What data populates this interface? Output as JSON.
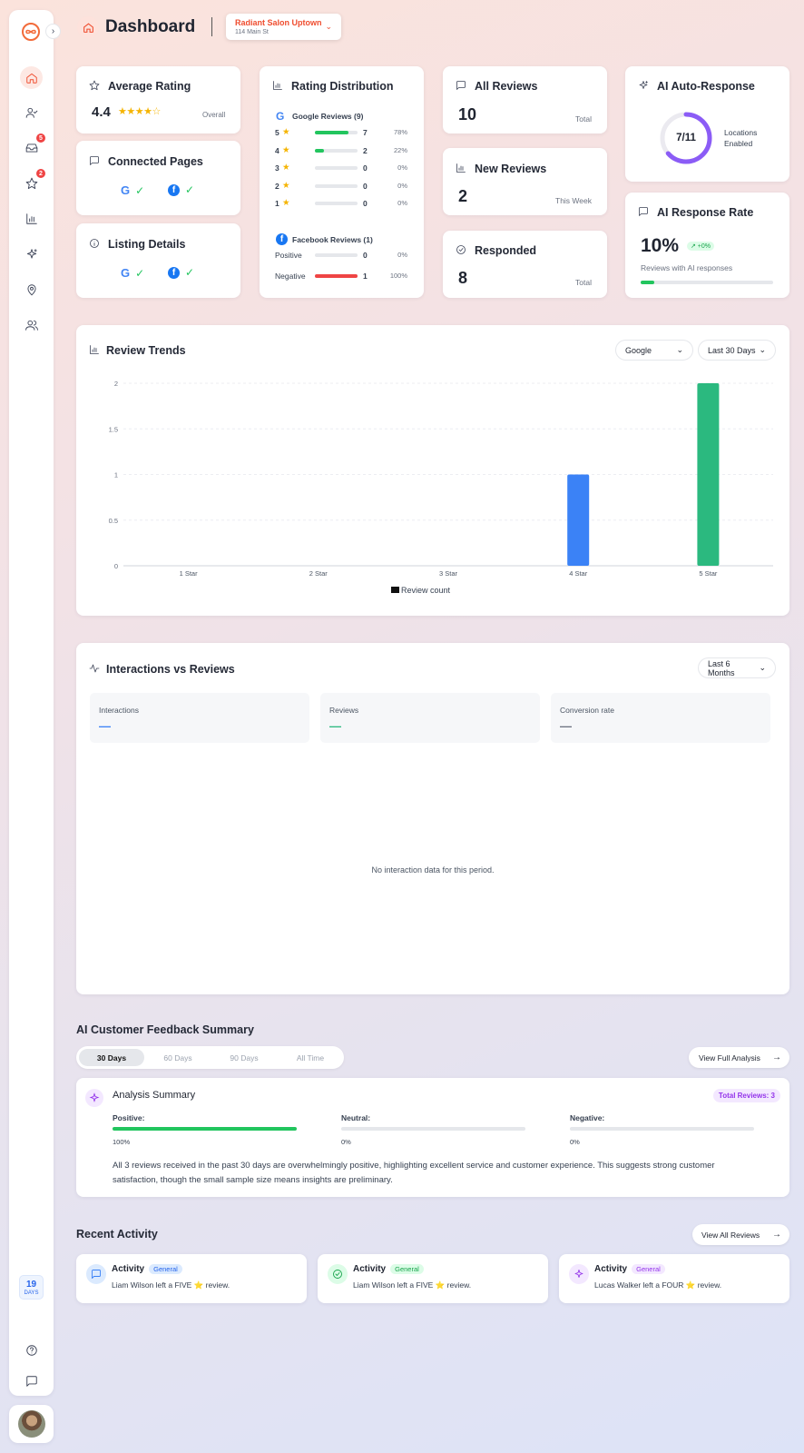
{
  "header": {
    "title": "Dashboard",
    "location_name": "Radiant Salon Uptown",
    "location_address": "114 Main St"
  },
  "sidebar": {
    "badge_inbox": "5",
    "badge_reviews": "2",
    "trial_days": "19",
    "trial_unit": "DAYS"
  },
  "avg_rating": {
    "title": "Average Rating",
    "value": "4.4",
    "stars": "★★★★☆",
    "label": "Overall",
    "rating": 4.4
  },
  "connected": {
    "title": "Connected Pages"
  },
  "listing": {
    "title": "Listing Details"
  },
  "dist": {
    "title": "Rating Distribution",
    "google_label": "Google Reviews (9)",
    "google_rows": [
      {
        "star": "5",
        "count": "7",
        "pct": "78%",
        "frac": 0.78
      },
      {
        "star": "4",
        "count": "2",
        "pct": "22%",
        "frac": 0.22
      },
      {
        "star": "3",
        "count": "0",
        "pct": "0%",
        "frac": 0
      },
      {
        "star": "2",
        "count": "0",
        "pct": "0%",
        "frac": 0
      },
      {
        "star": "1",
        "count": "0",
        "pct": "0%",
        "frac": 0
      }
    ],
    "facebook_label": "Facebook Reviews (1)",
    "fb_rows": [
      {
        "label": "Positive",
        "count": "0",
        "pct": "0%",
        "frac": 0
      },
      {
        "label": "Negative",
        "count": "1",
        "pct": "100%",
        "frac": 1
      }
    ]
  },
  "all_reviews": {
    "title": "All Reviews",
    "value": "10",
    "label": "Total"
  },
  "new_reviews": {
    "title": "New Reviews",
    "value": "2",
    "label": "This Week"
  },
  "responded": {
    "title": "Responded",
    "value": "8",
    "label": "Total"
  },
  "auto": {
    "title": "AI Auto-Response",
    "value": "7/11",
    "line1": "Locations",
    "line2": "Enabled",
    "frac": 0.636
  },
  "rate": {
    "title": "AI Response Rate",
    "value": "10%",
    "delta": "↗ +0%",
    "label": "Reviews with AI responses",
    "frac": 0.1
  },
  "trends": {
    "title": "Review Trends",
    "source": "Google",
    "range": "Last 30 Days"
  },
  "chart_data": {
    "type": "bar",
    "categories": [
      "1 Star",
      "2 Star",
      "3 Star",
      "4 Star",
      "5 Star"
    ],
    "series": [
      {
        "name": "Review count",
        "values": [
          0,
          0,
          0,
          1,
          2
        ]
      }
    ],
    "colors": [
      "#3b82f6",
      "#3b82f6",
      "#3b82f6",
      "#3b82f6",
      "#2bb97f"
    ],
    "ylim": [
      0,
      2
    ],
    "yticks": [
      "0",
      "0.5",
      "1",
      "1.5",
      "2"
    ],
    "legend": "bottom",
    "grid": true
  },
  "interactions": {
    "title": "Interactions vs Reviews",
    "range": "Last 6 Months",
    "stats": [
      {
        "label": "Interactions",
        "value": "—",
        "color": "#3b82f6"
      },
      {
        "label": "Reviews",
        "value": "—",
        "color": "#2bb97f"
      },
      {
        "label": "Conversion rate",
        "value": "—",
        "color": "#6b7280"
      }
    ],
    "empty": "No interaction data for this period."
  },
  "feedback": {
    "title": "AI Customer Feedback Summary",
    "tabs": [
      "30 Days",
      "60 Days",
      "90 Days",
      "All Time"
    ],
    "view_button": "View Full Analysis",
    "summary_title": "Analysis Summary",
    "total": "Total Reviews: 3",
    "positive_label": "Positive:",
    "positive_pct": "100%",
    "positive_frac": 1,
    "neutral_label": "Neutral:",
    "neutral_pct": "0%",
    "neutral_frac": 0,
    "negative_label": "Negative:",
    "negative_pct": "0%",
    "negative_frac": 0,
    "text": "All 3 reviews received in the past 30 days are overwhelmingly positive, highlighting excellent service and customer experience. This suggests strong customer satisfaction, though the small sample size means insights are preliminary."
  },
  "activity": {
    "title": "Recent Activity",
    "view_button": "View All Reviews",
    "items": [
      {
        "title": "Activity",
        "tag": "General",
        "text": "Liam Wilson left a FIVE ⭐ review."
      },
      {
        "title": "Activity",
        "tag": "General",
        "text": "Liam Wilson left a FIVE ⭐ review."
      },
      {
        "title": "Activity",
        "tag": "General",
        "text": "Lucas Walker left a FOUR ⭐ review."
      }
    ]
  }
}
